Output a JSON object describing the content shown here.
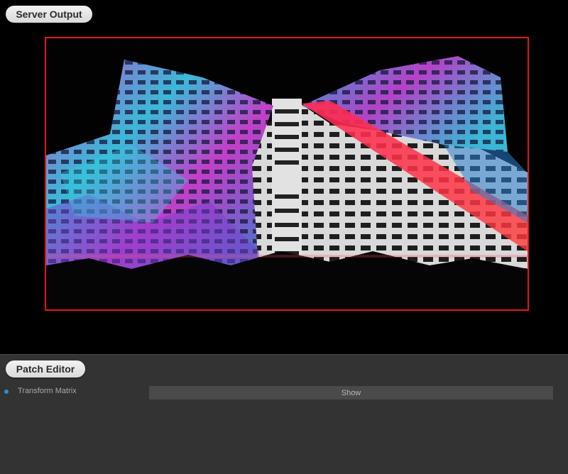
{
  "server_output": {
    "title": "Server Output",
    "frame_border_color": "#e01818"
  },
  "patch_editor": {
    "title": "Patch Editor",
    "parameters": [
      {
        "label": "Transform Matrix",
        "indicator_color": "#2a8fd6",
        "button_label": "Show"
      }
    ]
  },
  "colors": {
    "background": "#000000",
    "panel": "#333333",
    "button": "#4a4a4a",
    "pill": "#e6e6e6"
  },
  "icons": [
    "param-indicator-icon"
  ]
}
